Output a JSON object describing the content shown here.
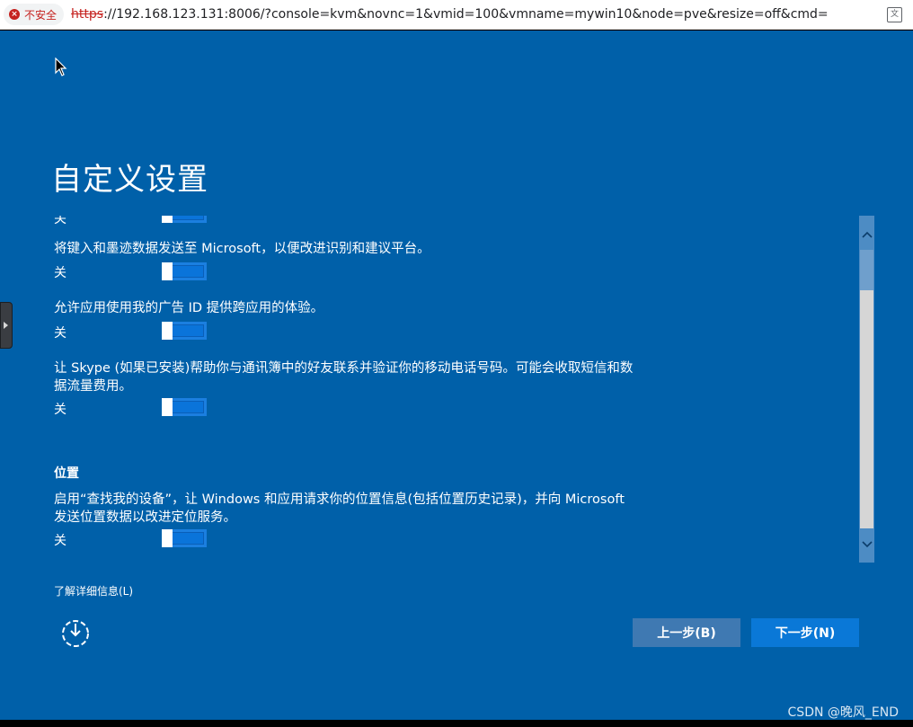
{
  "browser": {
    "security_label": "不安全",
    "url_scheme": "https",
    "url_rest": "://192.168.123.131:8006/?console=kvm&novnc=1&vmid=100&vmname=mywin10&node=pve&resize=off&cmd="
  },
  "page": {
    "title": "自定义设置",
    "settings": [
      {
        "text": "将键入和墨迹数据发送至 Microsoft，以便改进识别和建议平台。",
        "state": "关"
      },
      {
        "text": "允许应用使用我的广告 ID 提供跨应用的体验。",
        "state": "关"
      },
      {
        "text_line1": "让 Skype (如果已安装)帮助你与通讯簿中的好友联系并验证你的移动电话号码。可能会收取短信和数",
        "text_line2": "据流量费用。",
        "state": "关"
      }
    ],
    "partial_top_label": "关",
    "location": {
      "heading": "位置",
      "text_line1": "启用“查找我的设备”，让 Windows 和应用请求你的位置信息(包括位置历史记录)，并向 Microsoft",
      "text_line2": "发送位置数据以改进定位服务。",
      "state": "关"
    },
    "learn_more": "了解详细信息(L)",
    "back_button": "上一步(B)",
    "next_button": "下一步(N)"
  },
  "watermark": "CSDN @晚风_END",
  "icons": {
    "security": "warning-icon",
    "translate": "translate-icon",
    "accessibility": "ease-of-access-icon",
    "cursor": "mouse-cursor-icon"
  }
}
